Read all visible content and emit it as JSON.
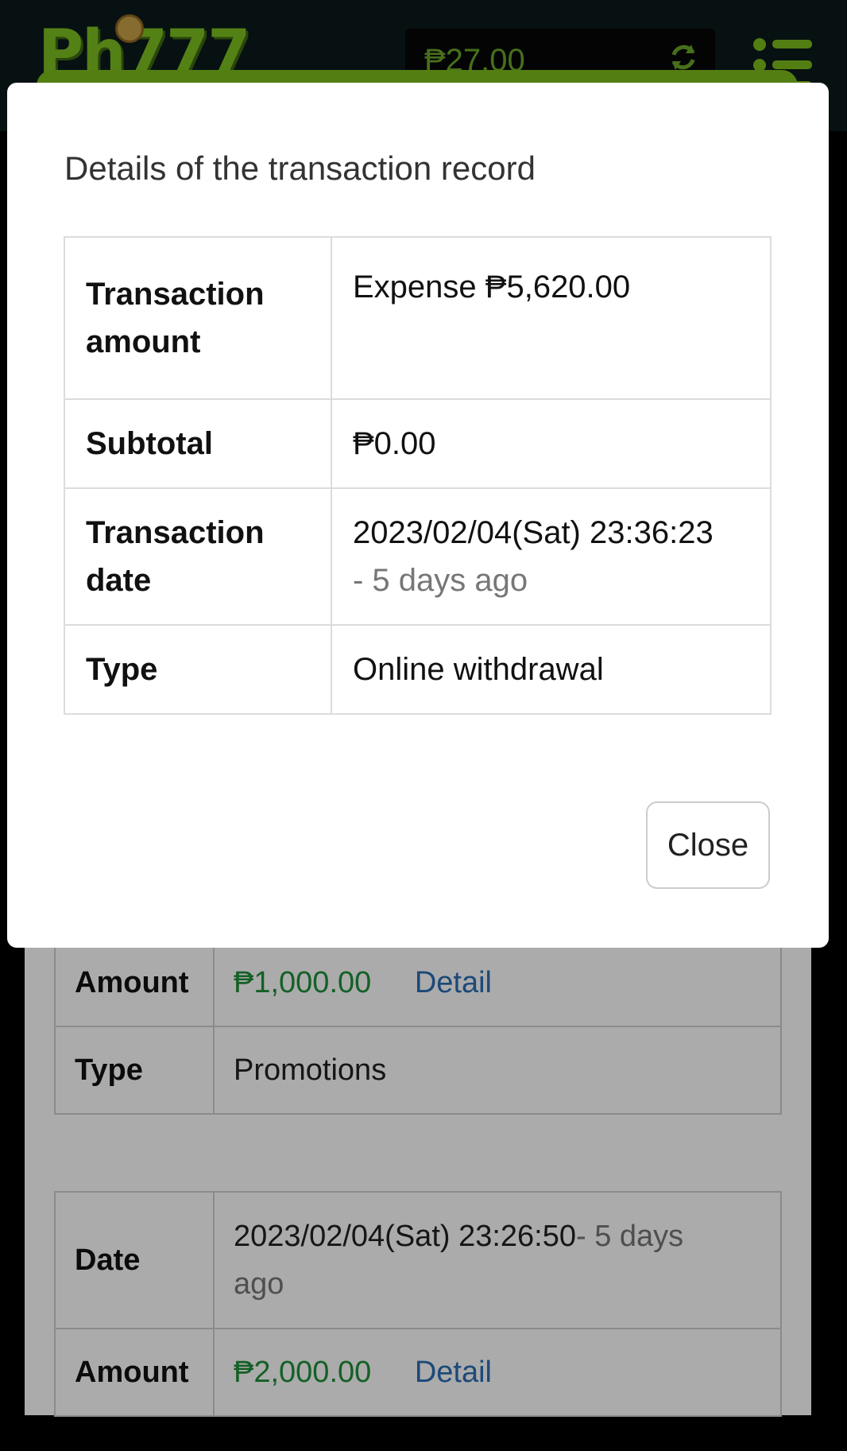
{
  "header": {
    "logo_text": "Ph777",
    "balance": "₱27.00"
  },
  "modal": {
    "title": "Details of the transaction record",
    "rows": [
      {
        "label": "Transaction amount",
        "value": "Expense ₱5,620.00"
      },
      {
        "label": "Subtotal",
        "value": "₱0.00"
      },
      {
        "label": "Transaction date",
        "value": "2023/02/04(Sat) 23:36:23",
        "sub": "- 5 days ago"
      },
      {
        "label": "Type",
        "value": "Online withdrawal"
      }
    ],
    "close_label": "Close"
  },
  "background": {
    "record1": {
      "amount_label": "Amount",
      "amount_value": "₱1,000.00",
      "detail_link": "Detail",
      "type_label": "Type",
      "type_value": "Promotions"
    },
    "record2": {
      "date_label": "Date",
      "date_value": "2023/02/04(Sat) 23:26:50",
      "date_relative": "- 5 days",
      "date_relative_2": "ago",
      "amount_label": "Amount",
      "amount_value": "₱2,000.00",
      "detail_link": "Detail"
    }
  },
  "colors": {
    "brand_green": "#7cbd1c",
    "expense_red": "#cf3232",
    "income_green": "#1f8f3a",
    "link_blue": "#2a6db3"
  }
}
